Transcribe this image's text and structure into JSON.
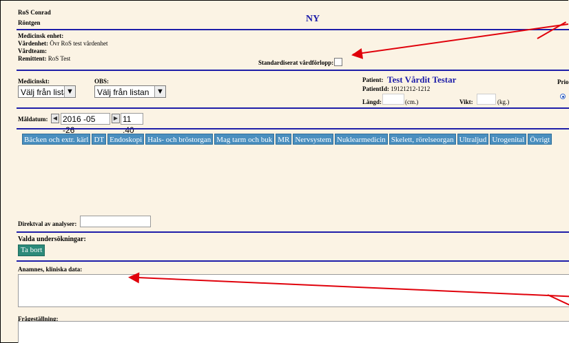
{
  "header": {
    "user_name": "RoS Conrad",
    "department": "Röntgen",
    "form_title": "NY"
  },
  "unit": {
    "medical_unit_label": "Medicinsk enhet:",
    "care_unit_label": "Vårdenhet:",
    "care_unit_value": "Övr RoS test vårdenhet",
    "care_team_label": "Vårdteam:",
    "referrer_label": "Remittent:",
    "referrer_value": "RoS Test",
    "standard_pathway_label": "Standardiserat vårdförlopp:"
  },
  "priority": {
    "medical_label": "Medicinskt:",
    "medical_select": "Välj från listan",
    "obs_label": "OBS:",
    "obs_select": "Välj från listan",
    "prio_label": "Prio"
  },
  "patient": {
    "label": "Patient:",
    "name": "Test Vårdit Testar",
    "id_label": "PatientId:",
    "id_value": "19121212-1212",
    "height_label": "Längd:",
    "height_unit": "(cm.)",
    "weight_label": "Vikt:",
    "weight_unit": "(kg.)"
  },
  "due": {
    "label": "Måldatum:",
    "date": "2016 -05 -26",
    "time": "11 :40",
    "prev_icon": "arrow-left-icon",
    "next_icon": "arrow-right-icon"
  },
  "tabs": [
    "Bäcken och extr. kärl",
    "DT",
    "Endoskopi",
    "Hals- och bröstorgan",
    "Mag tarm och buk",
    "MR",
    "Nervsystem",
    "Nuklearmedicin",
    "Skelett, rörelseorgan",
    "Ultraljud",
    "Urogenital",
    "Övrigt"
  ],
  "direct": {
    "label": "Direktval av analyser:"
  },
  "selected": {
    "label": "Valda undersökningar:",
    "remove_button": "Ta bort"
  },
  "anamnesis": {
    "label": "Anamnes, kliniska data:"
  },
  "question": {
    "label": "Frågeställning:"
  },
  "colors": {
    "background": "#fbf3e4",
    "divider": "#1c1ca8",
    "tab": "#4a8fbf",
    "button": "#2c8a7a",
    "annotation_arrow": "#e0000a",
    "title": "#1c1ca8"
  }
}
